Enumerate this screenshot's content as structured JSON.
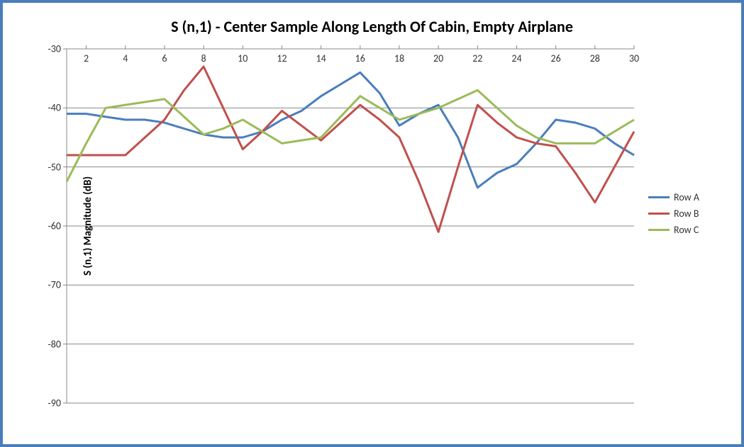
{
  "chart_data": {
    "type": "line",
    "title": "S (n,1) - Center Sample Along Length Of Cabin, Empty Airplane",
    "ylabel": "S (n,1) Magnitude (dB)",
    "xlabel": "",
    "x": [
      1,
      2,
      3,
      4,
      5,
      6,
      7,
      8,
      9,
      10,
      11,
      12,
      13,
      14,
      15,
      16,
      17,
      18,
      19,
      20,
      21,
      22,
      23,
      24,
      25,
      26,
      27,
      28,
      29,
      30
    ],
    "x_ticks": [
      2,
      4,
      6,
      8,
      10,
      12,
      14,
      16,
      18,
      20,
      22,
      24,
      26,
      28,
      30
    ],
    "ylim": [
      -90,
      -30
    ],
    "y_ticks": [
      -30,
      -40,
      -50,
      -60,
      -70,
      -80,
      -90
    ],
    "series": [
      {
        "name": "Row A",
        "color": "#4a7ebb",
        "values": [
          -41.0,
          -41.0,
          -41.5,
          -42.0,
          -42.0,
          -42.5,
          -43.5,
          -44.5,
          -45.0,
          -45.0,
          -44.0,
          -42.0,
          -40.5,
          -38.0,
          -36.0,
          -34.0,
          -37.5,
          -43.0,
          -41.0,
          -39.5,
          -45.0,
          -53.5,
          -51.0,
          -49.5,
          -46.0,
          -42.0,
          -42.5,
          -43.5,
          -46.0,
          -48.0
        ]
      },
      {
        "name": "Row B",
        "color": "#c0504d",
        "values": [
          -48.0,
          -48.0,
          -48.0,
          -48.0,
          -45.0,
          -42.0,
          -37.0,
          -33.0,
          -40.0,
          -47.0,
          -44.0,
          -40.5,
          -43.0,
          -45.5,
          -42.5,
          -39.5,
          -42.0,
          -45.0,
          -52.5,
          -61.0,
          -50.0,
          -39.5,
          -42.5,
          -45.0,
          -46.0,
          -46.5,
          -51.0,
          -56.0,
          -50.0,
          -44.0
        ]
      },
      {
        "name": "Row C",
        "color": "#9bbb59",
        "values": [
          -52.5,
          -46.0,
          -40.0,
          -39.5,
          -39.0,
          -38.5,
          -41.5,
          -44.5,
          -43.5,
          -42.0,
          -44.0,
          -46.0,
          -45.5,
          -45.0,
          -41.5,
          -38.0,
          -40.0,
          -42.0,
          -41.0,
          -40.0,
          -38.5,
          -37.0,
          -40.0,
          -43.0,
          -45.0,
          -46.0,
          -46.0,
          -46.0,
          -44.0,
          -42.0
        ]
      }
    ],
    "legend": [
      "Row A",
      "Row B",
      "Row C"
    ]
  }
}
